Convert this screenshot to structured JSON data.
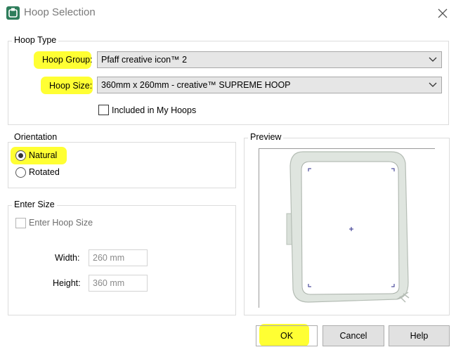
{
  "window": {
    "title": "Hoop Selection",
    "icon": "hoop-app-icon",
    "close_icon": "close-icon"
  },
  "hoop_type": {
    "legend": "Hoop Type",
    "group_label": "Hoop Group",
    "group_value": "Pfaff creative icon™ 2",
    "size_label": "Hoop Size",
    "size_value": "360mm x 260mm - creative™ SUPREME HOOP",
    "colon": ":",
    "included_label": "Included in My Hoops",
    "included_checked": false
  },
  "orientation": {
    "legend": "Orientation",
    "options": [
      {
        "label": "Natural",
        "selected": true
      },
      {
        "label": "Rotated",
        "selected": false
      }
    ]
  },
  "enter_size": {
    "legend": "Enter Size",
    "enter_label": "Enter Hoop Size",
    "enter_checked": false,
    "width_label": "Width:",
    "width_value": "260 mm",
    "height_label": "Height:",
    "height_value": "360 mm"
  },
  "preview": {
    "legend": "Preview"
  },
  "buttons": {
    "ok": "OK",
    "cancel": "Cancel",
    "help": "Help"
  },
  "colors": {
    "highlight": "#ffff33",
    "hoop_frame": "#dfe5df",
    "marker": "#2a2a8a"
  }
}
